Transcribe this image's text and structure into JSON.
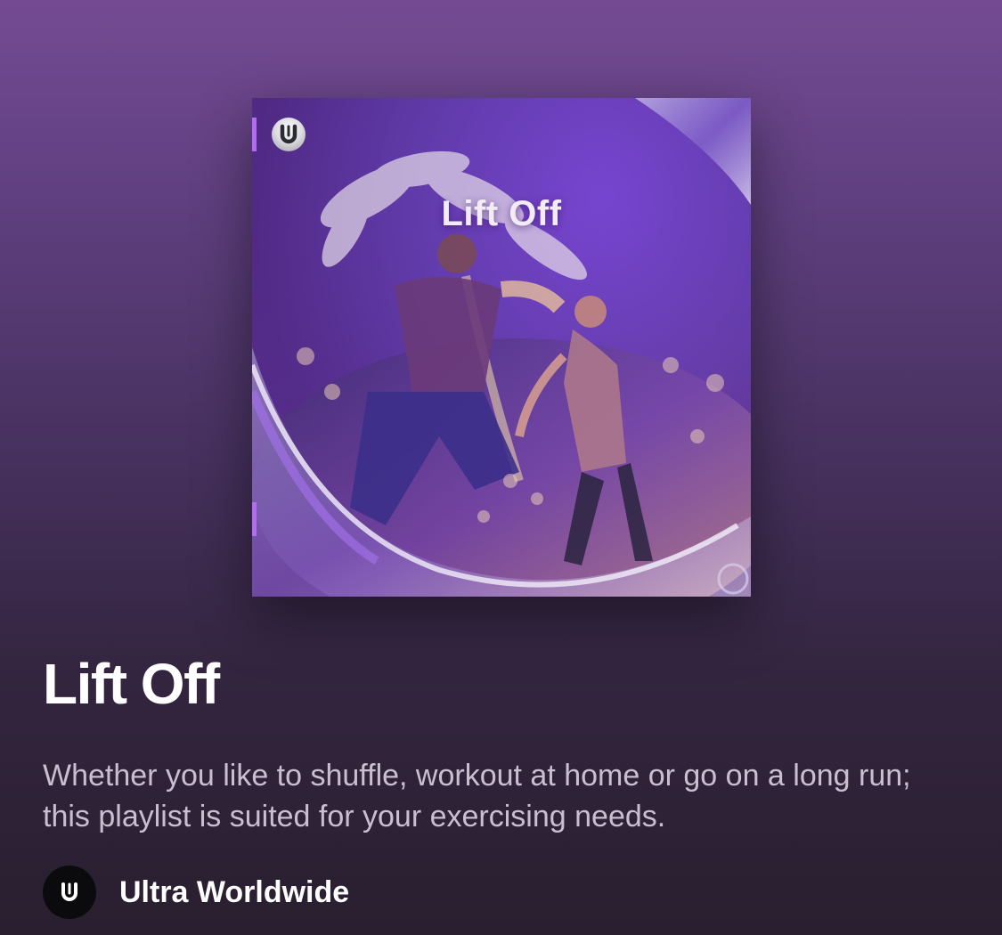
{
  "cover": {
    "overlay_title": "Lift Off",
    "logo_icon": "ultra-logo-icon"
  },
  "playlist": {
    "title": "Lift Off",
    "description": "Whether you like to shuffle, workout at home or go on a long run; this playlist is suited for your exercising needs."
  },
  "owner": {
    "name": "Ultra Worldwide",
    "avatar_icon": "ultra-logo-icon"
  },
  "colors": {
    "background_top": "#744b93",
    "background_bottom": "#291f2f",
    "accent": "#b16cf1",
    "description_text": "#c9bfd0"
  }
}
